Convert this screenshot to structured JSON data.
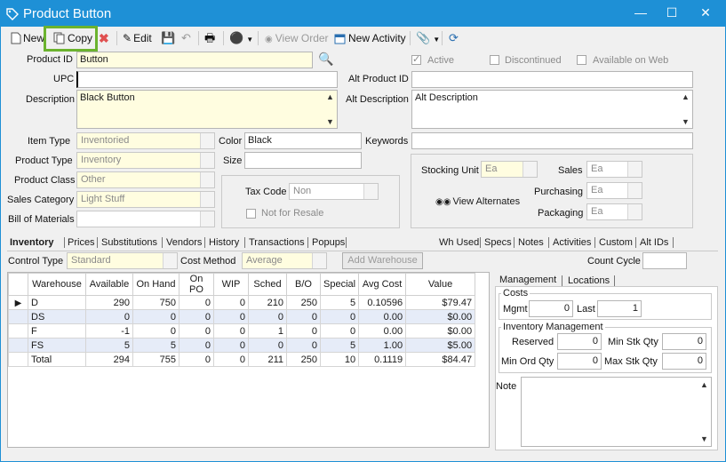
{
  "window": {
    "title": "Product Button"
  },
  "toolbar": {
    "new_label": "New",
    "copy_label": "Copy",
    "edit_label": "Edit",
    "view_order_label": "View Order",
    "new_activity_label": "New Activity"
  },
  "form": {
    "product_id_label": "Product ID",
    "product_id_value": "Button",
    "upc_label": "UPC",
    "upc_value": "",
    "description_label": "Description",
    "description_value": "Black Button",
    "active_label": "Active",
    "discontinued_label": "Discontinued",
    "available_web_label": "Available on Web",
    "alt_product_id_label": "Alt Product ID",
    "alt_product_id_value": "",
    "alt_description_label": "Alt Description",
    "alt_description_value": "Alt Description",
    "item_type_label": "Item Type",
    "item_type_value": "Inventoried",
    "product_type_label": "Product Type",
    "product_type_value": "Inventory",
    "product_class_label": "Product Class",
    "product_class_value": "Other",
    "sales_category_label": "Sales Category",
    "sales_category_value": "Light Stuff",
    "bom_label": "Bill of Materials",
    "bom_value": "",
    "color_label": "Color",
    "color_value": "Black",
    "size_label": "Size",
    "size_value": "",
    "keywords_label": "Keywords",
    "keywords_value": "",
    "tax_code_label": "Tax Code",
    "tax_code_value": "Non",
    "not_for_resale_label": "Not for Resale",
    "stocking_unit_label": "Stocking Unit",
    "stocking_unit_value": "Ea",
    "sales_label": "Sales",
    "sales_value": "Ea",
    "purchasing_label": "Purchasing",
    "purchasing_value": "Ea",
    "packaging_label": "Packaging",
    "packaging_value": "Ea",
    "view_alternates_label": "View Alternates"
  },
  "tabs_left": [
    "Inventory",
    "Prices",
    "Substitutions",
    "Vendors",
    "History",
    "Transactions",
    "Popups"
  ],
  "tabs_right": [
    "Wh Used",
    "Specs",
    "Notes",
    "Activities",
    "Custom",
    "Alt IDs"
  ],
  "inventory": {
    "control_type_label": "Control Type",
    "control_type_value": "Standard",
    "cost_method_label": "Cost Method",
    "cost_method_value": "Average",
    "add_warehouse_label": "Add Warehouse",
    "count_cycle_label": "Count Cycle",
    "count_cycle_value": "",
    "columns": [
      "Warehouse",
      "Available",
      "On Hand",
      "On PO",
      "WIP",
      "Sched",
      "B/O",
      "Special",
      "Avg Cost",
      "Value"
    ],
    "rows": [
      [
        "D",
        "290",
        "750",
        "0",
        "0",
        "210",
        "250",
        "5",
        "0.10596",
        "$79.47"
      ],
      [
        "DS",
        "0",
        "0",
        "0",
        "0",
        "0",
        "0",
        "0",
        "0.00",
        "$0.00"
      ],
      [
        "F",
        "-1",
        "0",
        "0",
        "0",
        "1",
        "0",
        "0",
        "0.00",
        "$0.00"
      ],
      [
        "FS",
        "5",
        "5",
        "0",
        "0",
        "0",
        "0",
        "5",
        "1.00",
        "$5.00"
      ],
      [
        "Total",
        "294",
        "755",
        "0",
        "0",
        "211",
        "250",
        "10",
        "0.1119",
        "$84.47"
      ]
    ]
  },
  "management": {
    "tab_management": "Management",
    "tab_locations": "Locations",
    "costs_label": "Costs",
    "mgmt_label": "Mgmt",
    "mgmt_value": "0",
    "last_label": "Last",
    "last_value": "1",
    "inv_mgmt_label": "Inventory Management",
    "reserved_label": "Reserved",
    "reserved_value": "0",
    "min_stk_label": "Min Stk Qty",
    "min_stk_value": "0",
    "min_ord_label": "Min Ord Qty",
    "min_ord_value": "0",
    "max_stk_label": "Max Stk Qty",
    "max_stk_value": "0",
    "note_label": "Note",
    "note_value": ""
  }
}
